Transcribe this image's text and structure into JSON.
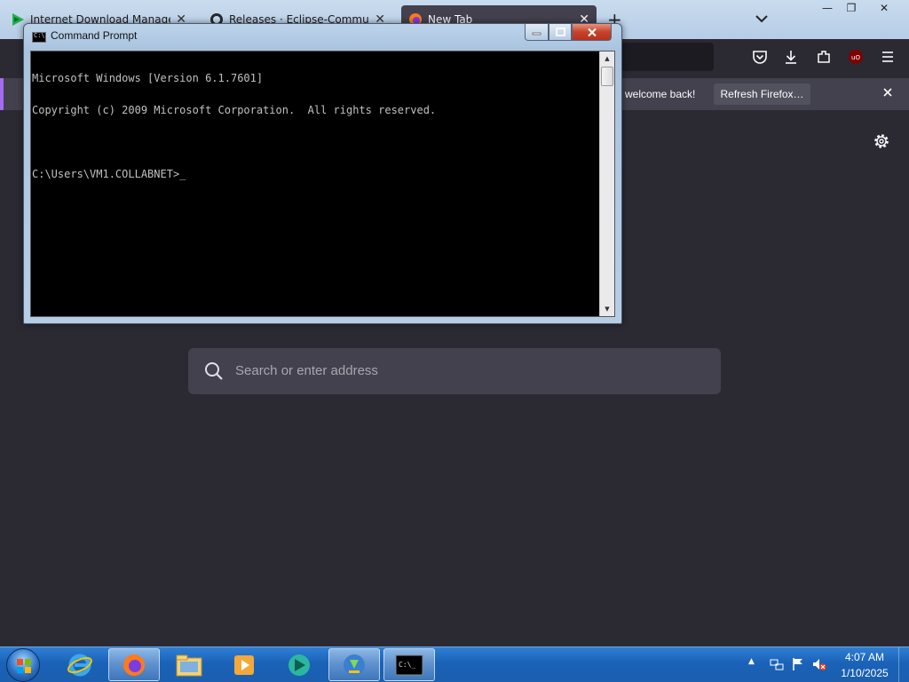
{
  "browser": {
    "tabs": [
      {
        "title": "Internet Download Manager is",
        "icon": "idm-arrow-icon"
      },
      {
        "title": "Releases · Eclipse-Community",
        "icon": "github-icon"
      },
      {
        "title": "New Tab",
        "icon": "firefox-icon",
        "active": true
      }
    ],
    "new_tab": "+",
    "window_controls": {
      "minimize": "—",
      "maximize": "❐",
      "close": "✕"
    },
    "toolbar_icons": [
      "pocket-icon",
      "downloads-icon",
      "extensions-icon",
      "ublock-icon",
      "menu-icon"
    ],
    "notification": {
      "message": "welcome back!",
      "refresh_button": "Refresh Firefox…"
    },
    "search": {
      "placeholder": "Search or enter address"
    }
  },
  "cmd": {
    "title": "Command Prompt",
    "icon_text": "C:\\.",
    "lines": [
      "Microsoft Windows [Version 6.1.7601]",
      "Copyright (c) 2009 Microsoft Corporation.  All rights reserved.",
      "",
      "C:\\Users\\VM1.COLLABNET>_"
    ]
  },
  "taskbar": {
    "pinned": [
      "internet-explorer-icon",
      "firefox-icon",
      "file-explorer-icon",
      "media-player-icon",
      "idm-icon",
      "idm-download-icon",
      "cmd-icon"
    ],
    "tray_arrow": "▲",
    "clock": {
      "time": "4:07 AM",
      "date": "1/10/2025"
    }
  }
}
